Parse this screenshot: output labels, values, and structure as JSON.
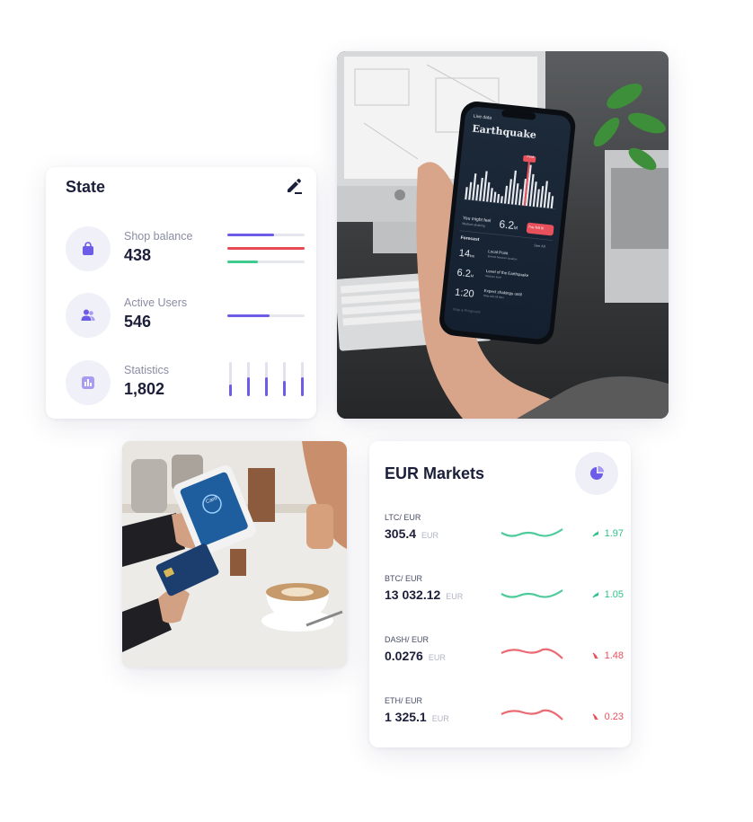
{
  "state_card": {
    "title": "State",
    "rows": [
      {
        "label": "Shop balance",
        "value": "438"
      },
      {
        "label": "Active Users",
        "value": "546"
      },
      {
        "label": "Statistics",
        "value": "1,802"
      }
    ],
    "shop_balance_bars": [
      0.6,
      1.0,
      0.4
    ],
    "active_users_bar": 0.55,
    "statistics_bars": [
      0.35,
      0.55,
      0.55,
      0.45,
      0.55
    ],
    "icons": {
      "edit": "pencil-icon",
      "shop": "shopping-bag-icon",
      "users": "users-icon",
      "stats": "bar-chart-icon"
    },
    "colors": {
      "accent": "#6c5ce7",
      "red": "#e84b56",
      "green": "#3dcb8e"
    }
  },
  "phone_photo": {
    "phone_title": "Earthquake",
    "back_label": "Live data",
    "feel_label": "You might feel",
    "feel_sub": "Medium shaking",
    "magnitude": "6.2",
    "magnitude_unit": "M",
    "felt_button": "I've felt it!",
    "forecast_label": "Forecast",
    "see_all": "See All",
    "chart_peak": "Peak",
    "items": [
      {
        "value": "14",
        "unit": "km",
        "title": "Local Point",
        "sub": "Embed between location"
      },
      {
        "value": "6.2",
        "unit": "M",
        "title": "Level of the Earthquake",
        "sub": "Medium level"
      },
      {
        "value": "1:20",
        "unit": "",
        "title": "Expect shakings until",
        "sub": "Stay safe till then"
      }
    ],
    "footer": "Map & Prognosis"
  },
  "payment_photo": {
    "terminal_label": "Card"
  },
  "eur_card": {
    "title": "EUR Markets",
    "pie_icon": "pie-chart-icon",
    "markets": [
      {
        "pair": "LTC/ EUR",
        "price": "305.4",
        "currency": "EUR",
        "change": "1.97",
        "trend": "up"
      },
      {
        "pair": "BTC/ EUR",
        "price": "13 032.12",
        "currency": "EUR",
        "change": "1.05",
        "trend": "up"
      },
      {
        "pair": "DASH/ EUR",
        "price": "0.0276",
        "currency": "EUR",
        "change": "1.48",
        "trend": "down"
      },
      {
        "pair": "ETH/ EUR",
        "price": "1 325.1",
        "currency": "EUR",
        "change": "0.23",
        "trend": "down"
      }
    ],
    "colors": {
      "up": "#2fc28a",
      "down": "#e8505b"
    }
  }
}
